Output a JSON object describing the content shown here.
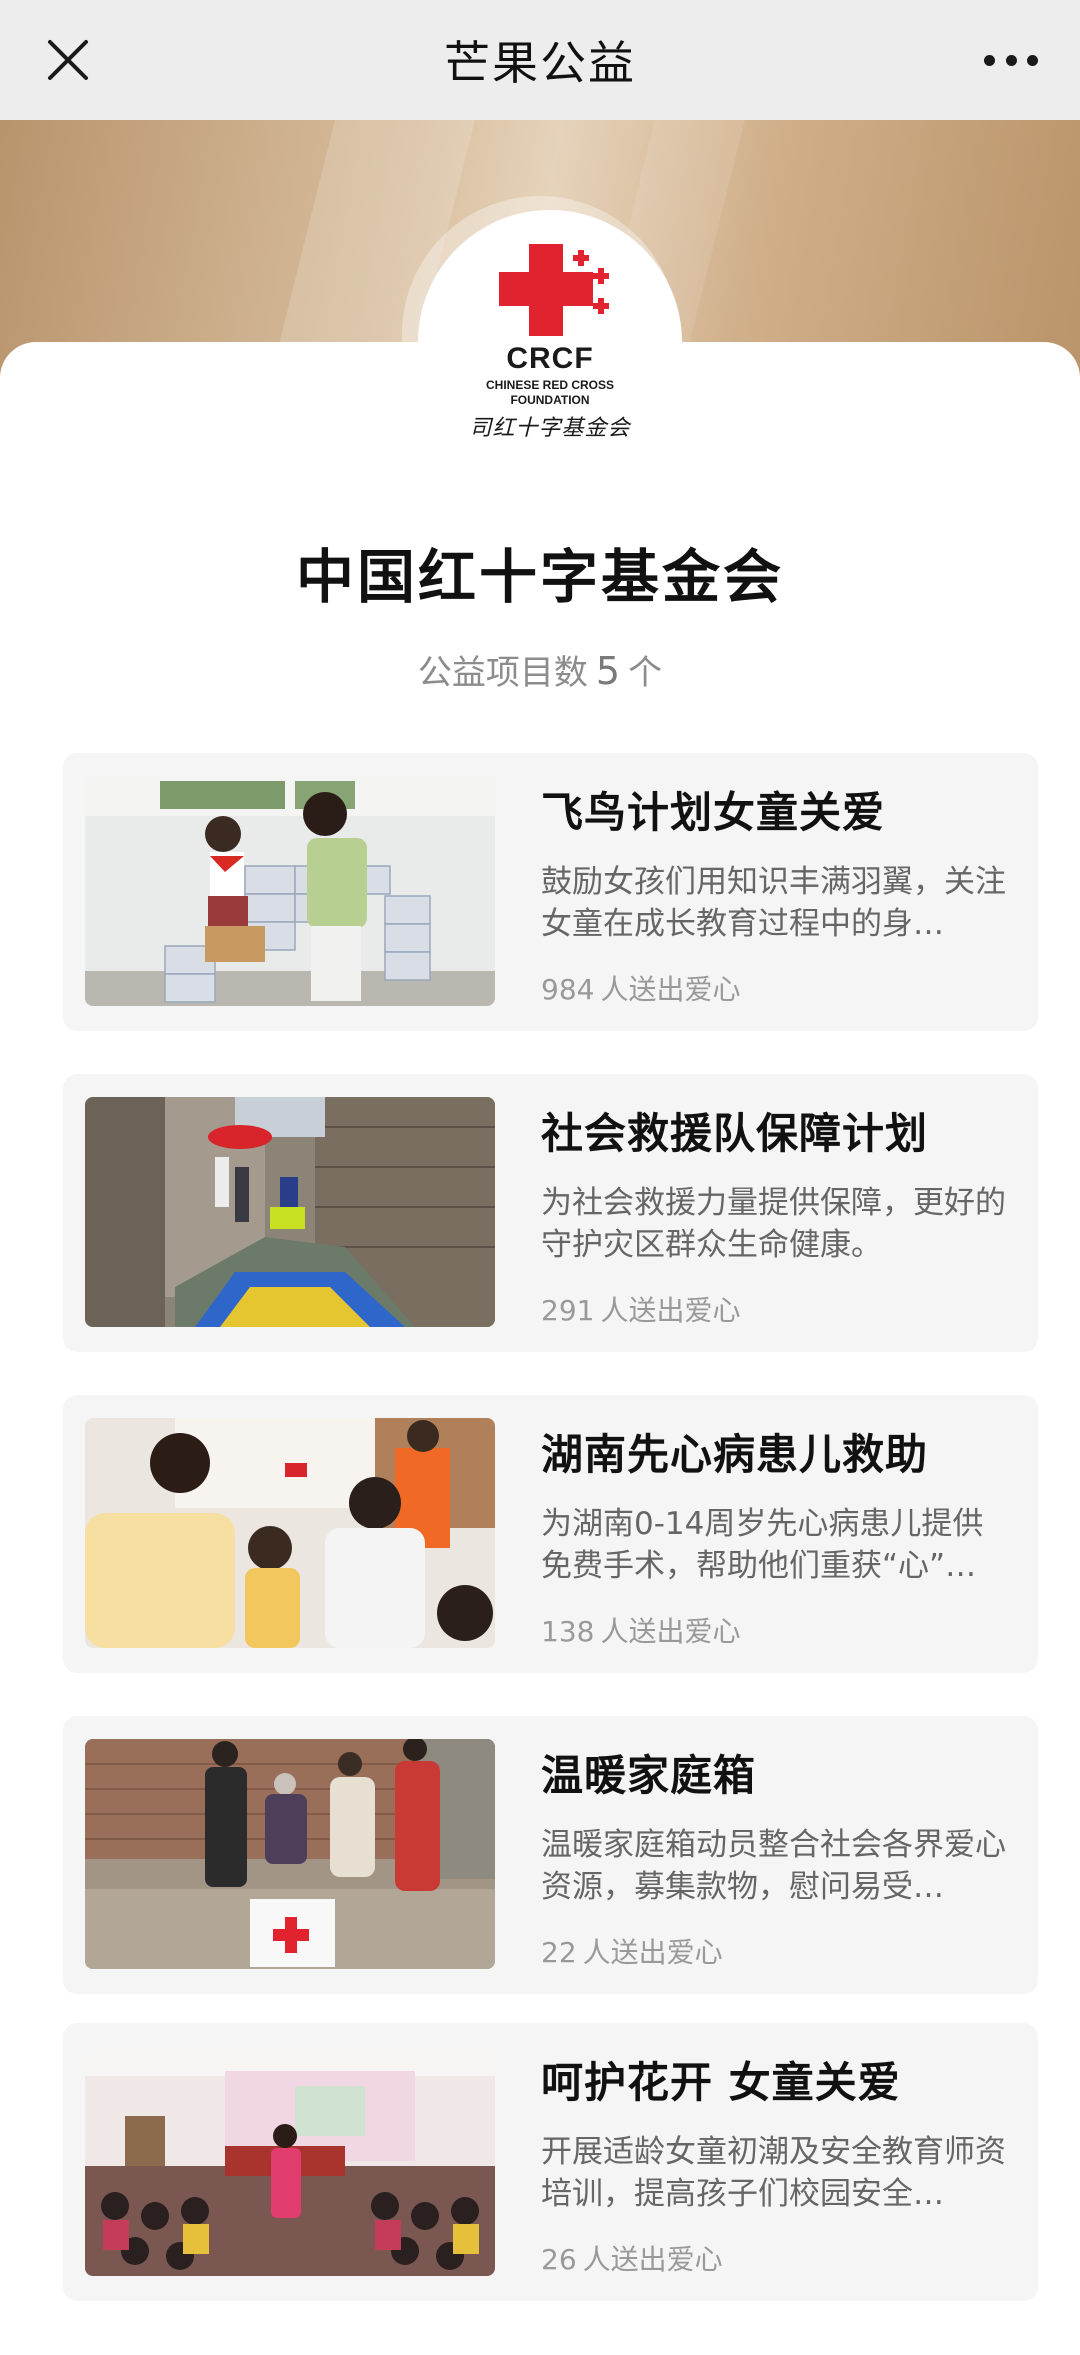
{
  "nav": {
    "title": "芒果公益",
    "close_icon": "close-icon",
    "more_icon": "more-dots-icon"
  },
  "logo": {
    "abbr": "CRCF",
    "en_line1": "CHINESE RED CROSS",
    "en_line2": "FOUNDATION",
    "cn": "司红十字基金会",
    "cross_color": "#e0232e"
  },
  "header": {
    "org_name": "中国红十字基金会",
    "count_prefix": "公益项目数",
    "count_value": "5",
    "count_suffix": "个"
  },
  "projects": [
    {
      "title": "飞鸟计划女童关爱",
      "desc": "鼓励女孩们用知识丰满羽翼，关注女童在成长教育过程中的身…",
      "count": "984",
      "count_label": "人送出爱心"
    },
    {
      "title": "社会救援队保障计划",
      "desc": "为社会救援力量提供保障，更好的守护灾区群众生命健康。",
      "count": "291",
      "count_label": "人送出爱心"
    },
    {
      "title": "湖南先心病患儿救助",
      "desc": "为湖南0-14周岁先心病患儿提供免费手术，帮助他们重获“心”…",
      "count": "138",
      "count_label": "人送出爱心"
    },
    {
      "title": "温暖家庭箱",
      "desc": "温暖家庭箱动员整合社会各界爱心资源，募集款物，慰问易受…",
      "count": "22",
      "count_label": "人送出爱心"
    },
    {
      "title": "呵护花开 女童关爱",
      "desc": "开展适龄女童初潮及安全教育师资培训，提高孩子们校园安全…",
      "count": "26",
      "count_label": "人送出爱心"
    }
  ]
}
